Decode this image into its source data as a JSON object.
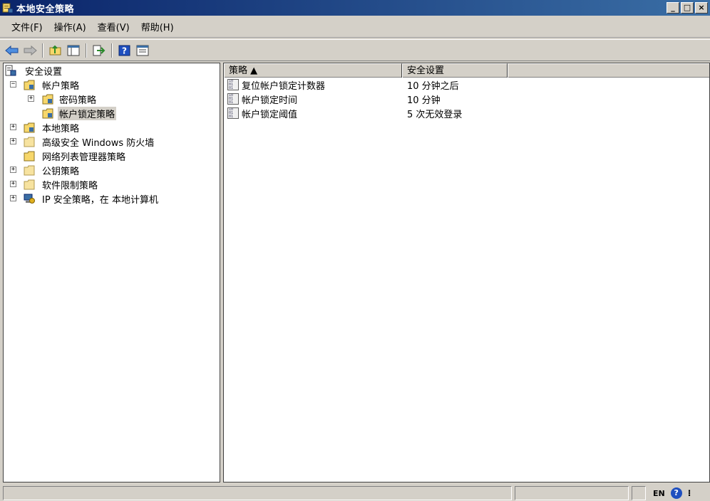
{
  "window": {
    "title": "本地安全策略",
    "min": "_",
    "max": "□",
    "close": "×"
  },
  "menu": [
    {
      "label": "文件(F)"
    },
    {
      "label": "操作(A)"
    },
    {
      "label": "查看(V)"
    },
    {
      "label": "帮助(H)"
    }
  ],
  "toolbar": {
    "icons": [
      "back-arrow-icon",
      "forward-arrow-icon",
      "up-folder-icon",
      "show-hide-tree-icon",
      "export-list-icon",
      "help-icon",
      "properties-icon"
    ]
  },
  "tree": {
    "root": "安全设置",
    "items": [
      {
        "label": "帐户策略",
        "expander": "−",
        "level": 1
      },
      {
        "label": "密码策略",
        "expander": "+",
        "level": 2
      },
      {
        "label": "帐户锁定策略",
        "expander": "",
        "level": 2,
        "selected": true
      },
      {
        "label": "本地策略",
        "expander": "+",
        "level": 1
      },
      {
        "label": "高级安全 Windows 防火墙",
        "expander": "+",
        "level": 1
      },
      {
        "label": "网络列表管理器策略",
        "expander": "",
        "level": 1
      },
      {
        "label": "公钥策略",
        "expander": "+",
        "level": 1
      },
      {
        "label": "软件限制策略",
        "expander": "+",
        "level": 1
      },
      {
        "label": "IP 安全策略，在 本地计算机",
        "expander": "+",
        "level": 1
      }
    ]
  },
  "list": {
    "columns": [
      {
        "label": "策略 ▲"
      },
      {
        "label": "安全设置"
      }
    ],
    "rows": [
      {
        "name": "复位帐户锁定计数器",
        "value": "10 分钟之后"
      },
      {
        "name": "帐户锁定时间",
        "value": "10 分钟"
      },
      {
        "name": "帐户锁定阈值",
        "value": "5 次无效登录"
      }
    ]
  },
  "statusbar": {
    "lang": "EN",
    "help": "?"
  },
  "colors": {
    "titlebar_start": "#0a246a",
    "titlebar_end": "#3a6ea5",
    "face": "#d4d0c8",
    "folder": "#f7d76b"
  }
}
